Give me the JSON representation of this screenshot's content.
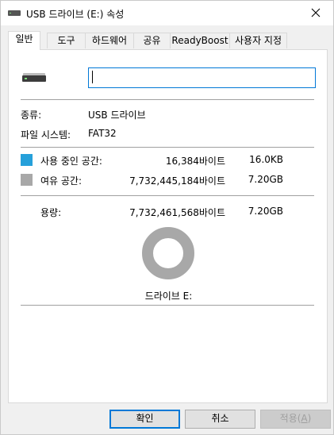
{
  "window": {
    "title": "USB 드라이브 (E:) 속성"
  },
  "tabs": [
    {
      "label": "일반",
      "active": true
    },
    {
      "label": "도구"
    },
    {
      "label": "하드웨어"
    },
    {
      "label": "공유"
    },
    {
      "label": "ReadyBoost"
    },
    {
      "label": "사용자 지정"
    }
  ],
  "general": {
    "name_value": "",
    "type_label": "종류:",
    "type_value": "USB 드라이브",
    "fs_label": "파일 시스템:",
    "fs_value": "FAT32",
    "used_label": "사용 중인 공간:",
    "used_bytes": "16,384바이트",
    "used_size": "16.0KB",
    "used_color": "#26a0da",
    "free_label": "여유 공간:",
    "free_bytes": "7,732,445,184바이트",
    "free_size": "7.20GB",
    "free_color": "#a8a8a8",
    "capacity_label": "용량:",
    "capacity_bytes": "7,732,461,568바이트",
    "capacity_size": "7.20GB",
    "drive_caption": "드라이브 E:",
    "used_fraction": 2.1e-06
  },
  "buttons": {
    "ok": "확인",
    "cancel": "취소",
    "apply_prefix": "적용(",
    "apply_accel": "A",
    "apply_suffix": ")"
  }
}
